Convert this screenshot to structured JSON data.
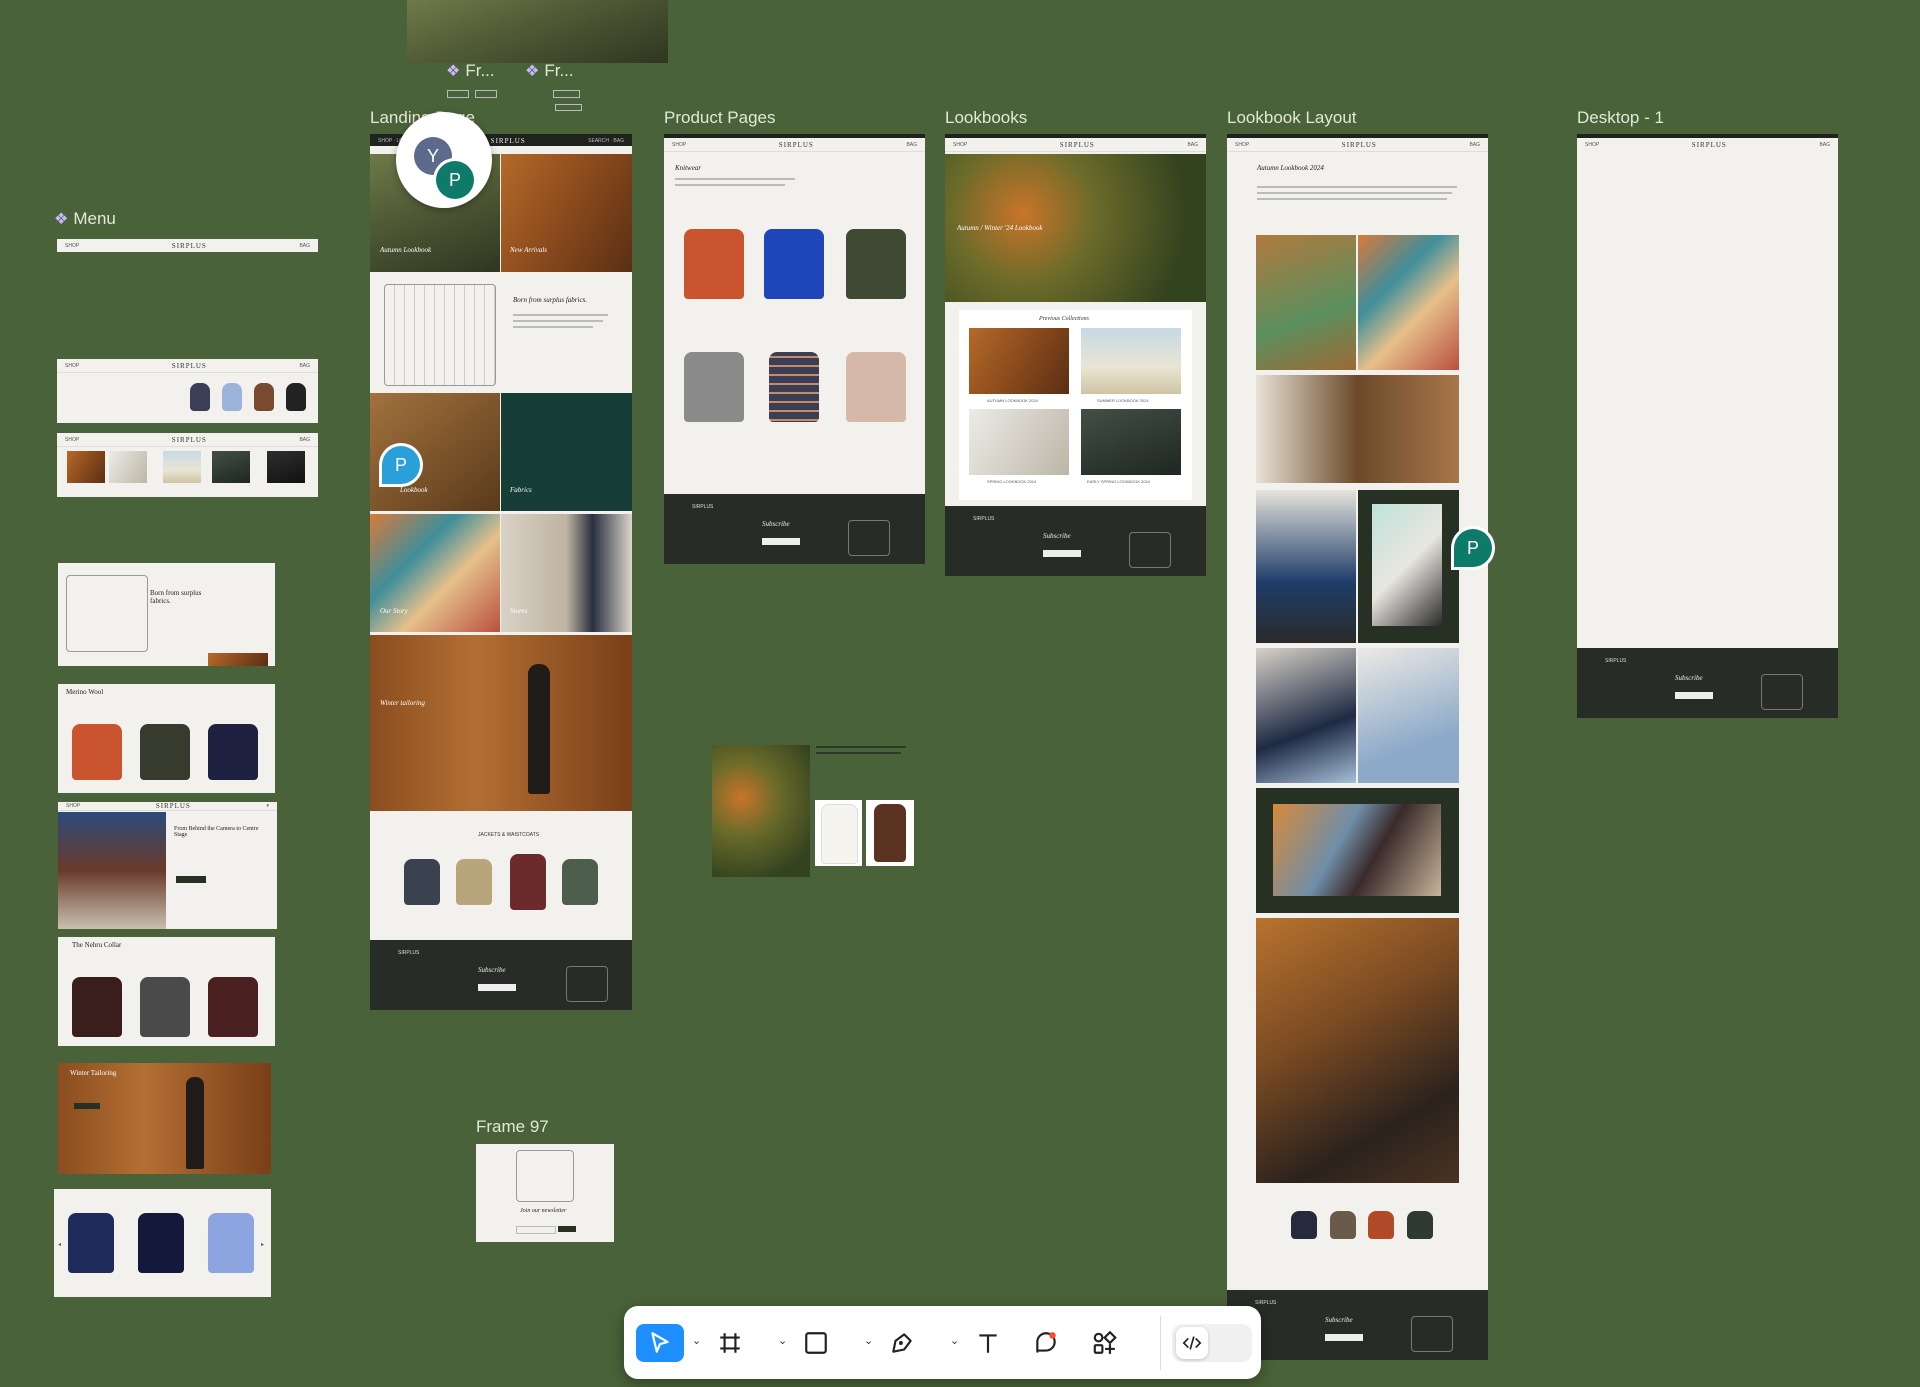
{
  "canvas": {
    "background": "#4a6239"
  },
  "frame_labels": {
    "landing_page": "Landing Page",
    "product_pages": "Product Pages",
    "lookbooks": "Lookbooks",
    "lookbook_layout": "Lookbook Layout",
    "desktop_1": "Desktop - 1",
    "menu": "Menu",
    "frame_97": "Frame 97",
    "component_a": "Fr...",
    "component_b": "Fr..."
  },
  "brand": "SIRPLUS",
  "landing": {
    "hero_left": "Autumn Lookbook",
    "hero_right": "New Arrivals",
    "story_heading": "Born from surplus fabrics.",
    "tile_lookbook": "Lookbook",
    "tile_fabrics": "Fabrics",
    "tile_story": "Our Story",
    "tile_stores": "Stores",
    "tailoring": "Winter tailoring",
    "jackets_heading": "JACKETS & WAISTCOATS",
    "footer_subscribe": "Subscribe",
    "footer_brand": "SIRPLUS"
  },
  "product": {
    "heading": "Knitwear",
    "footer_subscribe": "Subscribe",
    "footer_brand": "SIRPLUS"
  },
  "lookbooks": {
    "hero": "Autumn / Winter '24 Lookbook",
    "previous": "Previous Collections",
    "c1": "AUTUMN LOOKBOOK 2024",
    "c2": "SUMMER LOOKBOOK 2024",
    "c3": "SPRING LOOKBOOK 2024",
    "c4": "EARLY SPRING LOOKBOOK 2024",
    "footer_subscribe": "Subscribe",
    "footer_brand": "SIRPLUS"
  },
  "lookbook_layout": {
    "heading": "Autumn Lookbook 2024",
    "footer_subscribe": "Subscribe",
    "footer_brand": "SIRPLUS"
  },
  "desktop": {
    "footer_subscribe": "Subscribe",
    "footer_brand": "SIRPLUS"
  },
  "left_column": {
    "born": "Born from surplus fabrics.",
    "merino": "Merino Wool",
    "camera": "From Behind the Camera to Centre Stage",
    "nehru": "The Nehru Collar",
    "tailoring": "Winter Tailoring"
  },
  "frame97": {
    "heading": "Join our newsletter"
  },
  "avatars": {
    "y": "Y",
    "p": "P"
  },
  "colors": {
    "accent_blue": "#1e8fff",
    "avatar_slate": "#5d6a8c",
    "avatar_teal": "#0d7a6a",
    "avatar_blue": "#2a9fd8"
  },
  "toolbar_icons": [
    "move-tool",
    "frame-tool",
    "shape-tool",
    "pen-tool",
    "text-tool",
    "comment-tool",
    "actions-tool",
    "dev-mode-toggle"
  ]
}
